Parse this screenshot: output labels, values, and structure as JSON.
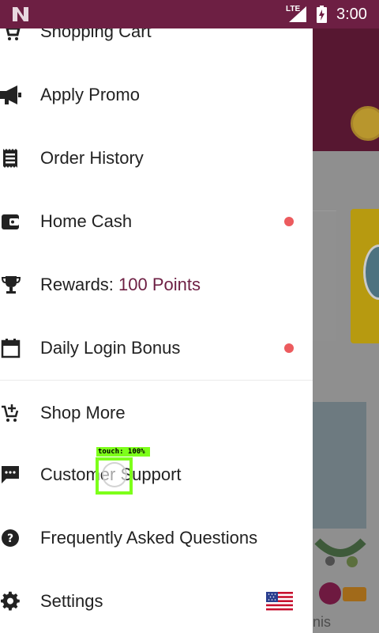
{
  "status_bar": {
    "network": "LTE",
    "time": "3:00"
  },
  "drawer": {
    "items": [
      {
        "label": "Shopping Cart",
        "icon": "cart-icon"
      },
      {
        "label": "Apply Promo",
        "icon": "megaphone-icon"
      },
      {
        "label": "Order History",
        "icon": "receipt-icon"
      },
      {
        "label": "Home Cash",
        "icon": "wallet-icon",
        "has_dot": true
      },
      {
        "label": "Rewards: ",
        "value": "100 Points",
        "icon": "trophy-icon"
      },
      {
        "label": "Daily Login Bonus",
        "icon": "calendar-icon",
        "has_dot": true
      },
      {
        "label": "Shop More",
        "icon": "add-cart-icon"
      },
      {
        "label": "Customer Support",
        "icon": "chat-icon"
      },
      {
        "label": "Frequently Asked Questions",
        "icon": "help-icon"
      },
      {
        "label": "Settings",
        "icon": "gear-icon",
        "trailing_icon": "us-flag-icon"
      }
    ]
  },
  "touch_indicator": {
    "label": "touch: 100%"
  },
  "background": {
    "partial_text": "nis"
  },
  "colors": {
    "status_bar": "#6d1f43",
    "accent": "#6d1f43",
    "dot": "#ec5b5e",
    "touch_overlay": "#7dff1a"
  }
}
